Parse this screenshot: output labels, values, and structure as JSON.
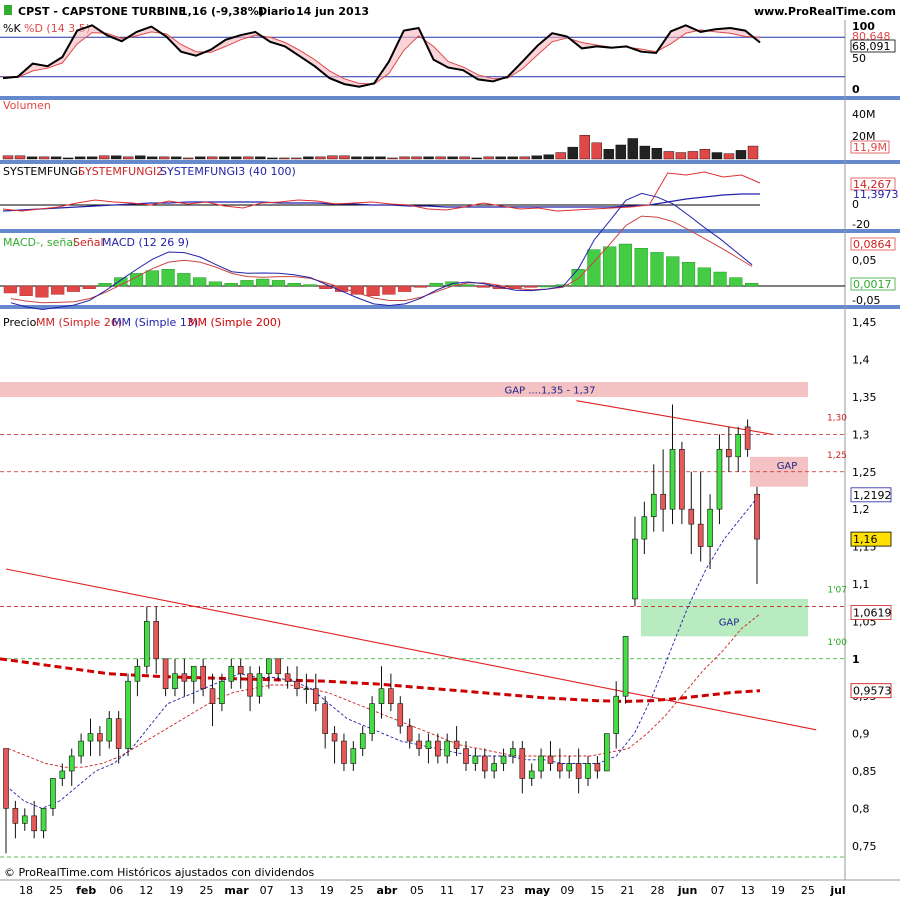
{
  "header": {
    "symbol": "CPST - CAPSTONE TURBINE",
    "quote": "1,16 (-9,38%)",
    "period": "Diario",
    "date": "14 jun 2013",
    "site": "www.ProRealTime.com"
  },
  "footer": {
    "text": "© ProRealTime.com  Históricos ajustados con dividendos"
  },
  "colors": {
    "up": "#33cc33",
    "down": "#e04848",
    "panel_border": "#6688cc",
    "ma26": "#cc2222",
    "ma13": "#2222aa",
    "ma200": "#cc0000",
    "gap_red": "#f4c2c2",
    "gap_green": "#b8ecc0"
  },
  "chart_data": [
    {
      "panel": "stochastic",
      "type": "line",
      "legend": [
        "%K",
        "%D (14 3 5)"
      ],
      "ylim": [
        0,
        100
      ],
      "tick_labels": [
        "100",
        "50",
        "0"
      ],
      "value_labels": [
        "80,648",
        "68,091"
      ],
      "reference_lines": [
        80,
        20
      ],
      "series": [
        {
          "name": "%K",
          "values": [
            18,
            20,
            40,
            36,
            50,
            90,
            98,
            83,
            74,
            88,
            96,
            81,
            58,
            52,
            61,
            76,
            83,
            88,
            73,
            66,
            51,
            36,
            18,
            9,
            5,
            10,
            43,
            90,
            94,
            46,
            34,
            30,
            16,
            13,
            20,
            43,
            67,
            86,
            81,
            63,
            66,
            64,
            66,
            58,
            56,
            89,
            98,
            88,
            92,
            94,
            90,
            72
          ]
        },
        {
          "name": "%D",
          "values": [
            20,
            19,
            29,
            33,
            41,
            70,
            87,
            86,
            78,
            82,
            88,
            85,
            69,
            58,
            57,
            66,
            76,
            83,
            80,
            72,
            60,
            46,
            29,
            17,
            10,
            9,
            25,
            60,
            82,
            66,
            43,
            35,
            23,
            17,
            18,
            32,
            53,
            73,
            79,
            72,
            68,
            65,
            65,
            62,
            58,
            70,
            86,
            91,
            88,
            86,
            81,
            80
          ]
        }
      ]
    },
    {
      "panel": "volume",
      "type": "bar",
      "title": "Volumen",
      "unit": "M",
      "tick_labels": [
        "40M",
        "20M"
      ],
      "value_label": "11,9M",
      "values": [
        3,
        3,
        2,
        2,
        2,
        1,
        2,
        2,
        3,
        3,
        2,
        3,
        2,
        2,
        2,
        1,
        2,
        2,
        2,
        2,
        2,
        2,
        1,
        1,
        1,
        2,
        2,
        3,
        3,
        2,
        2,
        2,
        1,
        2,
        2,
        2,
        2,
        2,
        2,
        1,
        2,
        2,
        2,
        2,
        3,
        4,
        6,
        11,
        22,
        15,
        9,
        13,
        19,
        12,
        10,
        7,
        6,
        7,
        9,
        6,
        5,
        8,
        12
      ]
    },
    {
      "panel": "systemfungi",
      "type": "line",
      "legend": [
        "SYSTEMFUNGI",
        "SYSTEMFUNGI2",
        "SYSTEMFUNGI3 (40 100)"
      ],
      "ylim": [
        -20,
        40
      ],
      "tick_labels": [
        "0",
        "-20"
      ],
      "value_labels": [
        "14,267",
        "11,3973"
      ],
      "series": [
        {
          "name": "SYSTEMFUNGI2",
          "values": [
            -4,
            -6,
            -4,
            -2,
            2,
            5,
            3,
            2,
            0,
            4,
            1,
            3,
            -1,
            -3,
            2,
            3,
            5,
            4,
            1,
            2,
            3,
            1,
            0,
            -4,
            -5,
            -2,
            2,
            -1,
            -4,
            -3,
            -6,
            -5,
            -4,
            -3,
            -2,
            0,
            32,
            30,
            33,
            28,
            30,
            22
          ]
        },
        {
          "name": "SYSTEMFUNGI3",
          "values": [
            -6,
            -5,
            -4,
            -3,
            -2,
            -1,
            0,
            1,
            2,
            2,
            3,
            3,
            3,
            3,
            3,
            2,
            2,
            2,
            1,
            1,
            0,
            0,
            -1,
            -1,
            -2,
            -2,
            -2,
            -2,
            -2,
            -2,
            -2,
            -2,
            -2,
            -2,
            -1,
            0,
            3,
            6,
            8,
            10,
            11,
            11
          ]
        }
      ]
    },
    {
      "panel": "macd",
      "type": "bar",
      "legend": [
        "MACD-, señal",
        "Señal",
        "MACD (12 26 9)"
      ],
      "tick_labels": [
        "0,05",
        "-0,05"
      ],
      "value_labels": [
        "0,0864",
        "0,0017"
      ],
      "values": [
        -0.005,
        -0.007,
        -0.008,
        -0.006,
        -0.004,
        -0.002,
        0.002,
        0.006,
        0.009,
        0.011,
        0.012,
        0.009,
        0.006,
        0.003,
        0.002,
        0.004,
        0.005,
        0.004,
        0.002,
        0.001,
        -0.002,
        -0.004,
        -0.006,
        -0.007,
        -0.006,
        -0.004,
        -0.001,
        0.002,
        0.003,
        0.001,
        -0.001,
        -0.002,
        -0.002,
        -0.001,
        0.0,
        0.001,
        0.012,
        0.026,
        0.028,
        0.03,
        0.027,
        0.024,
        0.021,
        0.017,
        0.013,
        0.01,
        0.006,
        0.002
      ]
    },
    {
      "panel": "price",
      "type": "candlestick",
      "legend": [
        "Precio",
        "MM (Simple 26)",
        "MM (Simple 13)",
        "MM (Simple 200)"
      ],
      "ylim": [
        0.725,
        1.475
      ],
      "y_ticks": [
        "1,45",
        "1,4",
        "1,35",
        "1,3",
        "1,25",
        "1,2",
        "1,15",
        "1,1",
        "1,05",
        "1",
        "0,95",
        "0,9",
        "0,85",
        "0,8",
        "0,75"
      ],
      "price_labels": {
        "current": "1,16",
        "ma13": "1,2192",
        "ma26": "1,0619",
        "ma200": "0,9573"
      },
      "level_labels": [
        "1,30",
        "1,25",
        "1'07",
        "1'00"
      ],
      "annotations": [
        "GAP ....1,35 - 1,37",
        "GAP",
        "GAP"
      ],
      "x_labels": [
        "18",
        "25",
        "feb",
        "06",
        "12",
        "19",
        "25",
        "mar",
        "07",
        "13",
        "19",
        "25",
        "abr",
        "05",
        "11",
        "17",
        "23",
        "may",
        "09",
        "15",
        "21",
        "28",
        "jun",
        "07",
        "13",
        "19",
        "25",
        "jul"
      ],
      "candles": [
        [
          0.88,
          0.88,
          0.74,
          0.8
        ],
        [
          0.8,
          0.81,
          0.76,
          0.78
        ],
        [
          0.78,
          0.8,
          0.77,
          0.79
        ],
        [
          0.79,
          0.81,
          0.76,
          0.77
        ],
        [
          0.77,
          0.8,
          0.76,
          0.8
        ],
        [
          0.8,
          0.84,
          0.79,
          0.84
        ],
        [
          0.84,
          0.86,
          0.83,
          0.85
        ],
        [
          0.85,
          0.88,
          0.83,
          0.87
        ],
        [
          0.87,
          0.9,
          0.86,
          0.89
        ],
        [
          0.89,
          0.92,
          0.87,
          0.9
        ],
        [
          0.9,
          0.91,
          0.87,
          0.89
        ],
        [
          0.89,
          0.93,
          0.88,
          0.92
        ],
        [
          0.92,
          0.93,
          0.86,
          0.88
        ],
        [
          0.88,
          0.98,
          0.87,
          0.97
        ],
        [
          0.97,
          1.0,
          0.95,
          0.99
        ],
        [
          0.99,
          1.07,
          0.98,
          1.05
        ],
        [
          1.05,
          1.07,
          0.98,
          1.0
        ],
        [
          1.0,
          1.0,
          0.95,
          0.96
        ],
        [
          0.96,
          1.0,
          0.95,
          0.98
        ],
        [
          0.98,
          1.0,
          0.95,
          0.97
        ],
        [
          0.97,
          0.99,
          0.94,
          0.99
        ],
        [
          0.99,
          1.0,
          0.95,
          0.96
        ],
        [
          0.96,
          0.98,
          0.91,
          0.94
        ],
        [
          0.94,
          0.98,
          0.93,
          0.97
        ],
        [
          0.97,
          1.0,
          0.96,
          0.99
        ],
        [
          0.99,
          1.0,
          0.96,
          0.98
        ],
        [
          0.98,
          0.99,
          0.93,
          0.95
        ],
        [
          0.95,
          0.99,
          0.94,
          0.98
        ],
        [
          0.98,
          1.0,
          0.96,
          1.0
        ],
        [
          1.0,
          1.0,
          0.97,
          0.98
        ],
        [
          0.98,
          0.99,
          0.96,
          0.97
        ],
        [
          0.97,
          0.99,
          0.95,
          0.96
        ],
        [
          0.96,
          0.98,
          0.94,
          0.96
        ],
        [
          0.96,
          0.98,
          0.93,
          0.94
        ],
        [
          0.94,
          0.95,
          0.88,
          0.9
        ],
        [
          0.9,
          0.91,
          0.86,
          0.89
        ],
        [
          0.89,
          0.9,
          0.85,
          0.86
        ],
        [
          0.86,
          0.89,
          0.85,
          0.88
        ],
        [
          0.88,
          0.91,
          0.87,
          0.9
        ],
        [
          0.9,
          0.95,
          0.89,
          0.94
        ],
        [
          0.94,
          0.99,
          0.92,
          0.96
        ],
        [
          0.96,
          0.98,
          0.93,
          0.94
        ],
        [
          0.94,
          0.95,
          0.9,
          0.91
        ],
        [
          0.91,
          0.92,
          0.88,
          0.89
        ],
        [
          0.89,
          0.9,
          0.87,
          0.88
        ],
        [
          0.88,
          0.9,
          0.86,
          0.89
        ],
        [
          0.89,
          0.9,
          0.86,
          0.87
        ],
        [
          0.87,
          0.9,
          0.86,
          0.89
        ],
        [
          0.89,
          0.91,
          0.87,
          0.88
        ],
        [
          0.88,
          0.89,
          0.85,
          0.86
        ],
        [
          0.86,
          0.88,
          0.85,
          0.87
        ],
        [
          0.87,
          0.88,
          0.84,
          0.85
        ],
        [
          0.85,
          0.87,
          0.84,
          0.86
        ],
        [
          0.86,
          0.88,
          0.85,
          0.87
        ],
        [
          0.87,
          0.89,
          0.86,
          0.88
        ],
        [
          0.88,
          0.89,
          0.82,
          0.84
        ],
        [
          0.84,
          0.86,
          0.83,
          0.85
        ],
        [
          0.85,
          0.88,
          0.84,
          0.87
        ],
        [
          0.87,
          0.89,
          0.85,
          0.86
        ],
        [
          0.86,
          0.88,
          0.84,
          0.85
        ],
        [
          0.85,
          0.87,
          0.84,
          0.86
        ],
        [
          0.86,
          0.88,
          0.82,
          0.84
        ],
        [
          0.84,
          0.87,
          0.83,
          0.86
        ],
        [
          0.86,
          0.87,
          0.84,
          0.85
        ],
        [
          0.85,
          0.9,
          0.85,
          0.9
        ],
        [
          0.9,
          0.97,
          0.88,
          0.95
        ],
        [
          0.95,
          1.03,
          0.94,
          1.03
        ],
        [
          1.08,
          1.19,
          1.07,
          1.16
        ],
        [
          1.16,
          1.21,
          1.14,
          1.19
        ],
        [
          1.19,
          1.26,
          1.17,
          1.22
        ],
        [
          1.22,
          1.28,
          1.17,
          1.2
        ],
        [
          1.2,
          1.34,
          1.18,
          1.28
        ],
        [
          1.28,
          1.29,
          1.18,
          1.2
        ],
        [
          1.2,
          1.25,
          1.14,
          1.18
        ],
        [
          1.18,
          1.25,
          1.13,
          1.15
        ],
        [
          1.15,
          1.22,
          1.12,
          1.2
        ],
        [
          1.2,
          1.3,
          1.18,
          1.28
        ],
        [
          1.28,
          1.31,
          1.25,
          1.27
        ],
        [
          1.27,
          1.31,
          1.25,
          1.3
        ],
        [
          1.31,
          1.32,
          1.27,
          1.28
        ],
        [
          1.22,
          1.23,
          1.1,
          1.16
        ]
      ],
      "ma13": [
        0.83,
        0.81,
        0.8,
        0.81,
        0.83,
        0.85,
        0.86,
        0.88,
        0.91,
        0.94,
        0.95,
        0.96,
        0.97,
        0.98,
        0.975,
        0.975,
        0.97,
        0.96,
        0.94,
        0.92,
        0.91,
        0.9,
        0.89,
        0.885,
        0.88,
        0.875,
        0.87,
        0.87,
        0.87,
        0.865,
        0.865,
        0.86,
        0.86,
        0.86,
        0.87,
        0.9,
        0.95,
        1.01,
        1.07,
        1.12,
        1.16,
        1.19,
        1.22
      ],
      "ma26": [
        0.88,
        0.87,
        0.86,
        0.855,
        0.855,
        0.86,
        0.87,
        0.885,
        0.9,
        0.915,
        0.93,
        0.945,
        0.955,
        0.96,
        0.965,
        0.965,
        0.96,
        0.955,
        0.945,
        0.935,
        0.925,
        0.915,
        0.905,
        0.895,
        0.885,
        0.88,
        0.875,
        0.87,
        0.87,
        0.87,
        0.87,
        0.87,
        0.875,
        0.88,
        0.9,
        0.925,
        0.955,
        0.985,
        1.01,
        1.04,
        1.06
      ],
      "ma200": [
        1.0,
        0.995,
        0.99,
        0.985,
        0.98,
        0.978,
        0.976,
        0.975,
        0.974,
        0.973,
        0.972,
        0.971,
        0.97,
        0.968,
        0.966,
        0.963,
        0.96,
        0.957,
        0.954,
        0.951,
        0.948,
        0.946,
        0.944,
        0.943,
        0.944,
        0.947,
        0.951,
        0.955,
        0.9573
      ],
      "reference_levels": [
        1.3,
        1.25,
        1.07,
        1.0,
        0.735
      ],
      "trendlines": [
        {
          "from": [
            0,
            1.12
          ],
          "to": [
            121,
            0.905
          ]
        },
        {
          "from": [
            92,
            1.345
          ],
          "to": [
            114,
            1.3
          ]
        }
      ],
      "zones": [
        {
          "label": "GAP ....1,35 - 1,37",
          "y": [
            1.35,
            1.37
          ]
        },
        {
          "label": "GAP",
          "y": [
            1.23,
            1.27
          ]
        },
        {
          "label": "GAP",
          "y": [
            1.03,
            1.08
          ]
        }
      ]
    }
  ]
}
